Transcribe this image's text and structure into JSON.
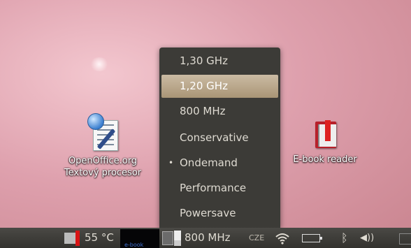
{
  "desktop": {
    "icons": [
      {
        "label_line1": "OpenOffice.org",
        "label_line2": "Textový procesor"
      },
      {
        "label": "E-book reader"
      }
    ]
  },
  "cpu_menu": {
    "items": [
      {
        "label": "1,30 GHz",
        "selected": false,
        "checked": false
      },
      {
        "label": "1,20 GHz",
        "selected": true,
        "checked": false
      },
      {
        "label": "800 MHz",
        "selected": false,
        "checked": false
      },
      {
        "label": "Conservative",
        "selected": false,
        "checked": false
      },
      {
        "label": "Ondemand",
        "selected": false,
        "checked": true
      },
      {
        "label": "Performance",
        "selected": false,
        "checked": false
      },
      {
        "label": "Powersave",
        "selected": false,
        "checked": false
      }
    ],
    "check_mark": "•"
  },
  "panel": {
    "temperature": "55 °C",
    "cpu_frequency": "800 MHz",
    "keyboard_layout": "CZE",
    "volume_symbol": "◀))",
    "bluetooth_symbol": "ᛒ",
    "obscured_text": "e-book"
  },
  "colors": {
    "menu_bg": "#3c3b37",
    "menu_highlight": "#b8a689",
    "panel_bg": "#3b3a36",
    "wallpaper": "#dea0ad"
  }
}
